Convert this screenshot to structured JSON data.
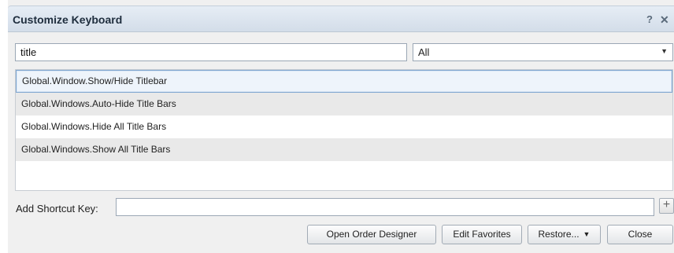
{
  "dialog": {
    "title": "Customize Keyboard",
    "help_label": "?",
    "close_label": "✕"
  },
  "search": {
    "value": "title"
  },
  "filter": {
    "selected": "All"
  },
  "results": [
    "Global.Window.Show/Hide Titlebar",
    "Global.Windows.Auto-Hide Title Bars",
    "Global.Windows.Hide All Title Bars",
    "Global.Windows.Show All Title Bars"
  ],
  "shortcut": {
    "label": "Add Shortcut Key:",
    "value": "",
    "add_label": "+"
  },
  "buttons": {
    "open_order_designer": "Open Order Designer",
    "edit_favorites": "Edit Favorites",
    "restore": "Restore...",
    "close": "Close"
  }
}
